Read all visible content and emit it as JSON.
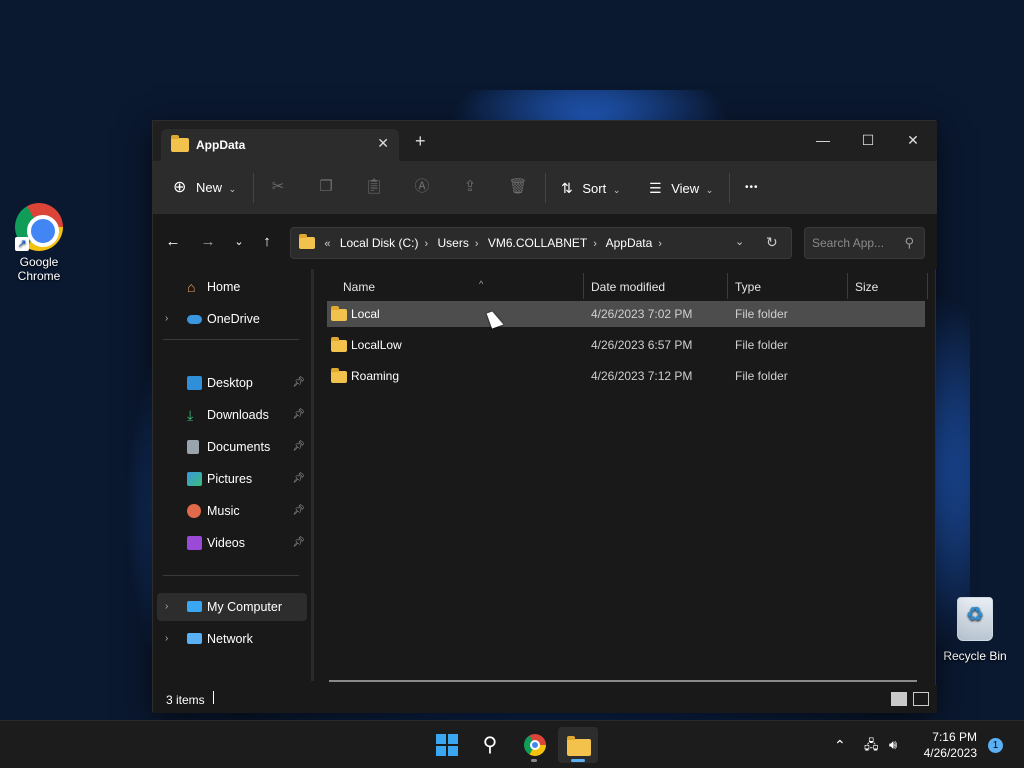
{
  "desktop": {
    "icons": [
      {
        "label": "Google Chrome",
        "icon": "chrome-icon"
      },
      {
        "label": "Recycle Bin",
        "icon": "recycle-bin-icon"
      }
    ]
  },
  "window": {
    "tab_title": "AppData",
    "toolbar": {
      "new_label": "New",
      "sort_label": "Sort",
      "view_label": "View",
      "more_label": "•••"
    },
    "address": {
      "crumbs": [
        "Local Disk (C:)",
        "Users",
        "VM6.COLLABNET",
        "AppData"
      ],
      "overflow": "«"
    },
    "search": {
      "placeholder": "Search App..."
    },
    "nav": {
      "home": "Home",
      "onedrive": "OneDrive",
      "quick": [
        "Desktop",
        "Downloads",
        "Documents",
        "Pictures",
        "Music",
        "Videos"
      ],
      "my_computer": "My Computer",
      "network": "Network"
    },
    "columns": [
      "Name",
      "Date modified",
      "Type",
      "Size"
    ],
    "rows": [
      {
        "name": "Local",
        "date": "4/26/2023 7:02 PM",
        "type": "File folder",
        "selected": true
      },
      {
        "name": "LocalLow",
        "date": "4/26/2023 6:57 PM",
        "type": "File folder",
        "selected": false
      },
      {
        "name": "Roaming",
        "date": "4/26/2023 7:12 PM",
        "type": "File folder",
        "selected": false
      }
    ],
    "status": {
      "count": "3 items"
    }
  },
  "taskbar": {
    "time": "7:16 PM",
    "date": "4/26/2023",
    "notifications": "1"
  },
  "colors": {
    "accent": "#5ab0f5",
    "folder": "#f2c24d",
    "window_bg": "#191919"
  }
}
